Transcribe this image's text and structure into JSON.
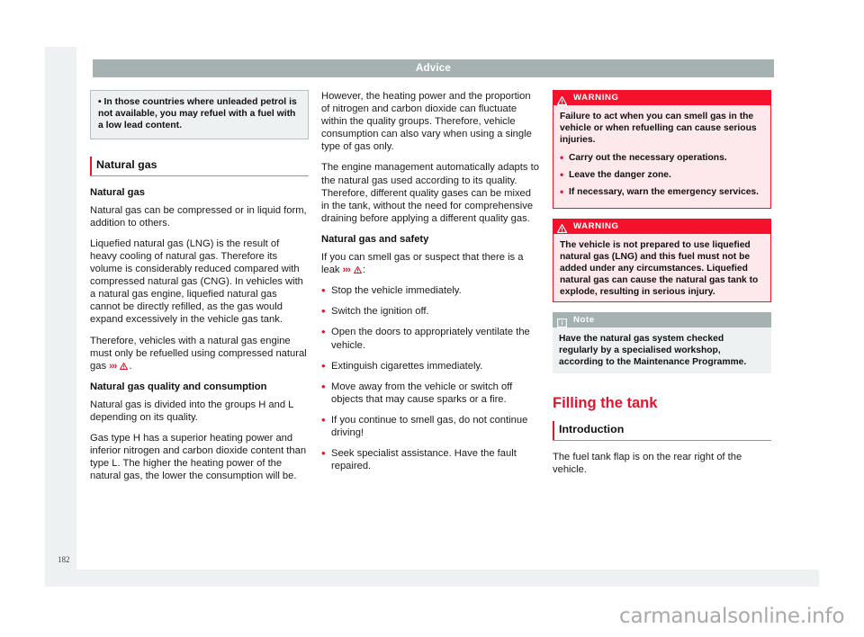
{
  "header": {
    "title": "Advice"
  },
  "page": {
    "number": "182",
    "watermark": "carmanualsonline.info"
  },
  "left_column": {
    "callout": {
      "bullet": "•",
      "text": "In those countries where unleaded petrol is not available, you may refuel with a fuel with a low lead content."
    },
    "section_heading": "Natural gas",
    "subhead_1": "Natural gas",
    "para_1": "Natural gas can be compressed or in liquid form, addition to others.",
    "para_2": "Liquefied natural gas (LNG) is the result of heavy cooling of natural gas. Therefore its volume is considerably reduced compared with compressed natural gas (CNG). In vehicles with a natural gas engine, liquefied natural gas cannot be directly refilled, as the gas would expand excessively in the vehicle gas tank.",
    "para_3_pre": "Therefore, vehicles with a natural gas engine must only be refuelled using compressed natural gas ",
    "para_3_ref": "›››",
    "para_3_post": ".",
    "subhead_2": "Natural gas quality and consumption",
    "para_4": "Natural gas is divided into the groups H and L depending on its quality.",
    "para_5": "Gas type H has a superior heating power and inferior nitrogen and carbon dioxide content than type L. The higher the heating power of the natural gas, the lower the consumption will be."
  },
  "mid_column": {
    "para_1": "However, the heating power and the proportion of nitrogen and carbon dioxide can fluctuate within the quality groups. Therefore, vehicle consumption can also vary when using a single type of gas only.",
    "para_2": "The engine management automatically adapts to the natural gas used according to its quality. Therefore, different quality gases can be mixed in the tank, without the need for comprehensive draining before applying a different quality gas.",
    "subhead_1": "Natural gas and safety",
    "para_3_pre": "If you can smell gas or suspect that there is a leak ",
    "para_3_ref": "›››",
    "para_3_post": ":",
    "bullets": [
      "Stop the vehicle immediately.",
      "Switch the ignition off.",
      "Open the doors to appropriately ventilate the vehicle.",
      "Extinguish cigarettes immediately.",
      "Move away from the vehicle or switch off objects that may cause sparks or a fire.",
      "If you continue to smell gas, do not continue driving!",
      "Seek specialist assistance. Have the fault repaired."
    ]
  },
  "right_column": {
    "warning_1": {
      "label": "WARNING",
      "body": "Failure to act when you can smell gas in the vehicle or when refuelling can cause serious injuries.",
      "bullets": [
        "Carry out the necessary operations.",
        "Leave the danger zone.",
        "If necessary, warn the emergency services."
      ]
    },
    "warning_2": {
      "label": "WARNING",
      "body": "The vehicle is not prepared to use liquefied natural gas (LNG) and this fuel must not be added under any circumstances. Liquefied natural gas can cause the natural gas tank to explode, resulting in serious injury."
    },
    "note": {
      "label": "Note",
      "body": "Have the natural gas system checked regularly by a specialised workshop, according to the Maintenance Programme."
    },
    "chapter_title": "Filling the tank",
    "section_heading": "Introduction",
    "para_1": "The fuel tank flap is on the rear right of the vehicle."
  },
  "colors": {
    "accent_red": "#e8112d",
    "warning_red": "#f4112c",
    "warning_bg": "#fde8ec",
    "note_gray": "#a6b2b2",
    "note_bg": "#eef1f2",
    "page_bg": "#eef1f2"
  }
}
